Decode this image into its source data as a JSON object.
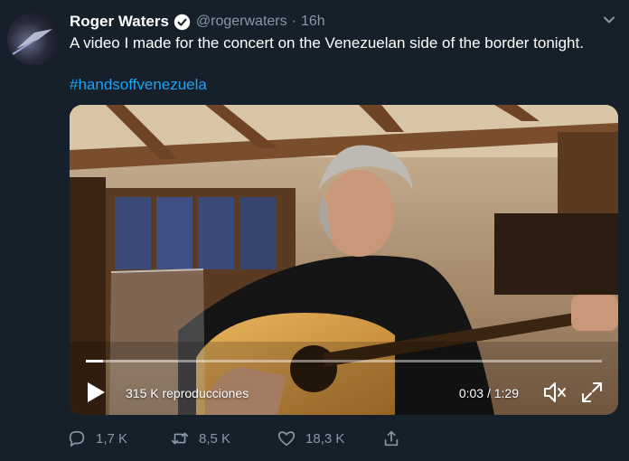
{
  "tweet": {
    "author_name": "Roger Waters",
    "author_handle": "@rogerwaters",
    "separator": "·",
    "timestamp": "16h",
    "text": "A video I made for the concert on the Venezuelan side of the border tonight.",
    "hashtag": "#handsoffvenezuela"
  },
  "video": {
    "views": "315 K reproducciones",
    "time": "0:03 / 1:29",
    "progress_fraction": 0.034
  },
  "actions": {
    "reply_count": "1,7 K",
    "retweet_count": "8,5 K",
    "like_count": "18,3 K"
  },
  "icons": {
    "verified": "verified-badge-icon",
    "caret": "chevron-down-icon",
    "play": "play-icon",
    "mute": "mute-icon",
    "fullscreen": "fullscreen-icon",
    "reply": "reply-icon",
    "retweet": "retweet-icon",
    "like": "heart-icon",
    "share": "share-icon"
  },
  "colors": {
    "background": "#15202b",
    "accent": "#1da1f2",
    "secondary_text": "#8899a6"
  }
}
